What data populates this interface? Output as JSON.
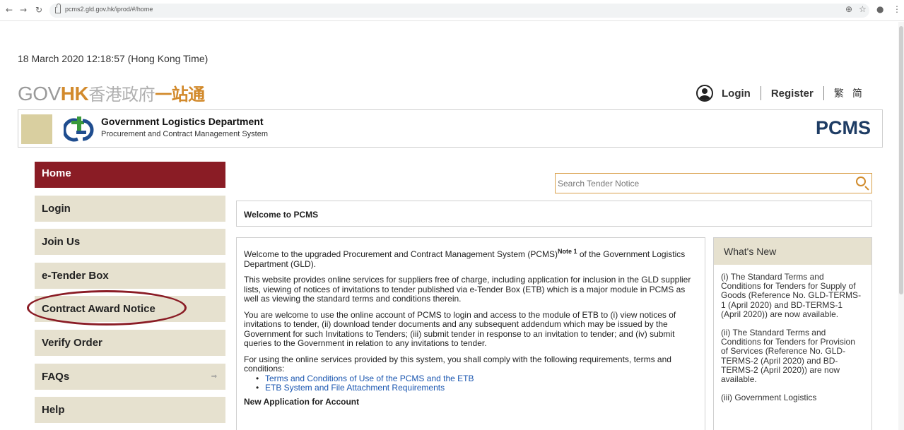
{
  "browser": {
    "url": "pcms2.gld.gov.hk/iprod/#/home"
  },
  "datetime": "18 March 2020 12:18:57 (Hong Kong Time)",
  "govhk": {
    "gov": "GOV",
    "hk": "HK",
    "zh1": "香港政府",
    "zh2": "一站通"
  },
  "userbar": {
    "login": "Login",
    "register": "Register",
    "lang_tc": "繁",
    "lang_sc": "简"
  },
  "header": {
    "department": "Government Logistics Department",
    "system": "Procurement and Contract Management System",
    "logo_text": "PCMS"
  },
  "sidebar": {
    "items": [
      {
        "label": "Home"
      },
      {
        "label": "Login"
      },
      {
        "label": "Join Us"
      },
      {
        "label": "e-Tender Box"
      },
      {
        "label": "Contract Award Notice"
      },
      {
        "label": "Verify Order"
      },
      {
        "label": "FAQs"
      },
      {
        "label": "Help"
      }
    ],
    "faq_arrow": "⇒"
  },
  "search": {
    "placeholder": "Search Tender Notice"
  },
  "welcome_title": "Welcome to PCMS",
  "content": {
    "p1_a": "Welcome to the upgraded Procurement and Contract Management System (PCMS)",
    "p1_note": "Note 1",
    "p1_b": " of the Government Logistics Department (GLD).",
    "p2": "This website provides online services for suppliers free of charge, including application for inclusion in the GLD supplier lists, viewing of notices of invitations to tender published via e-Tender Box (ETB) which is a major module in PCMS as well as viewing the standard terms and conditions therein.",
    "p3": "You are welcome to use the online account of PCMS to login and access to the module of ETB to (i) view notices of invitations to tender, (ii) download tender documents and any subsequent addendum which may be issued by the Government for such Invitations to Tenders; (iii) submit tender in response to an invitation to tender; and (iv) submit queries to the Government in relation to any invitations to tender.",
    "p4": "For using the online services provided by this system, you shall comply with the following requirements, terms and conditions:",
    "links": [
      "Terms and Conditions of Use of the PCMS and the ETB",
      "ETB System and File Attachment Requirements"
    ],
    "section_title": "New Application for Account"
  },
  "whats_new": {
    "title": "What's New",
    "items": [
      "(i) The Standard Terms and Conditions for Tenders for Supply of Goods (Reference No. GLD-TERMS-1 (April 2020) and BD-TERMS-1 (April 2020)) are now available.",
      "(ii) The Standard Terms and Conditions for Tenders for Provision of Services (Reference No. GLD-TERMS-2 (April 2020) and BD-TERMS-2 (April 2020)) are now available.",
      "(iii) Government Logistics"
    ]
  },
  "colors": {
    "active_nav": "#8a1c25",
    "nav_bg": "#e6e1cf",
    "brand_navy": "#1e3c64",
    "govhk_orange": "#d28a2c",
    "link_blue": "#1a56b0"
  }
}
